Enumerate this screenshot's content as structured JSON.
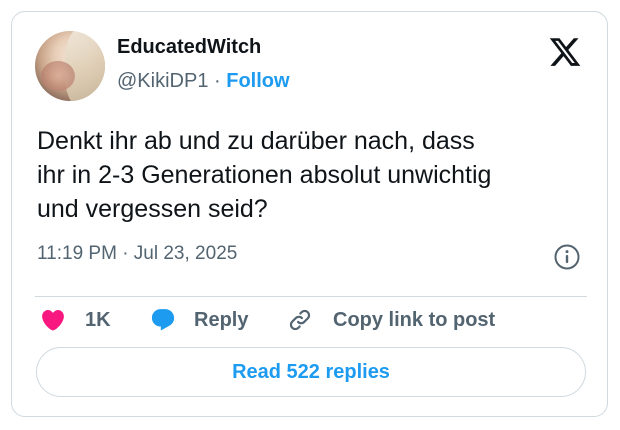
{
  "author": {
    "display_name": "EducatedWitch",
    "handle": "@KikiDP1",
    "separator": "·",
    "follow_label": "Follow",
    "avatar_icon": "profile-photo"
  },
  "platform_icon": "x-logo-icon",
  "tweet": {
    "text": "Denkt ihr ab und zu darüber nach, dass\nihr in 2-3 Generationen absolut unwichtig\nund vergessen seid?",
    "timestamp": "11:19 PM · Jul 23, 2025"
  },
  "actions": {
    "like_count": "1K",
    "reply_label": "Reply",
    "copy_link_label": "Copy link to post"
  },
  "read_replies_label": "Read 522 replies",
  "colors": {
    "accent": "#1d9bf0",
    "like": "#f91880",
    "text_secondary": "#536471",
    "border": "#cfd9de"
  }
}
